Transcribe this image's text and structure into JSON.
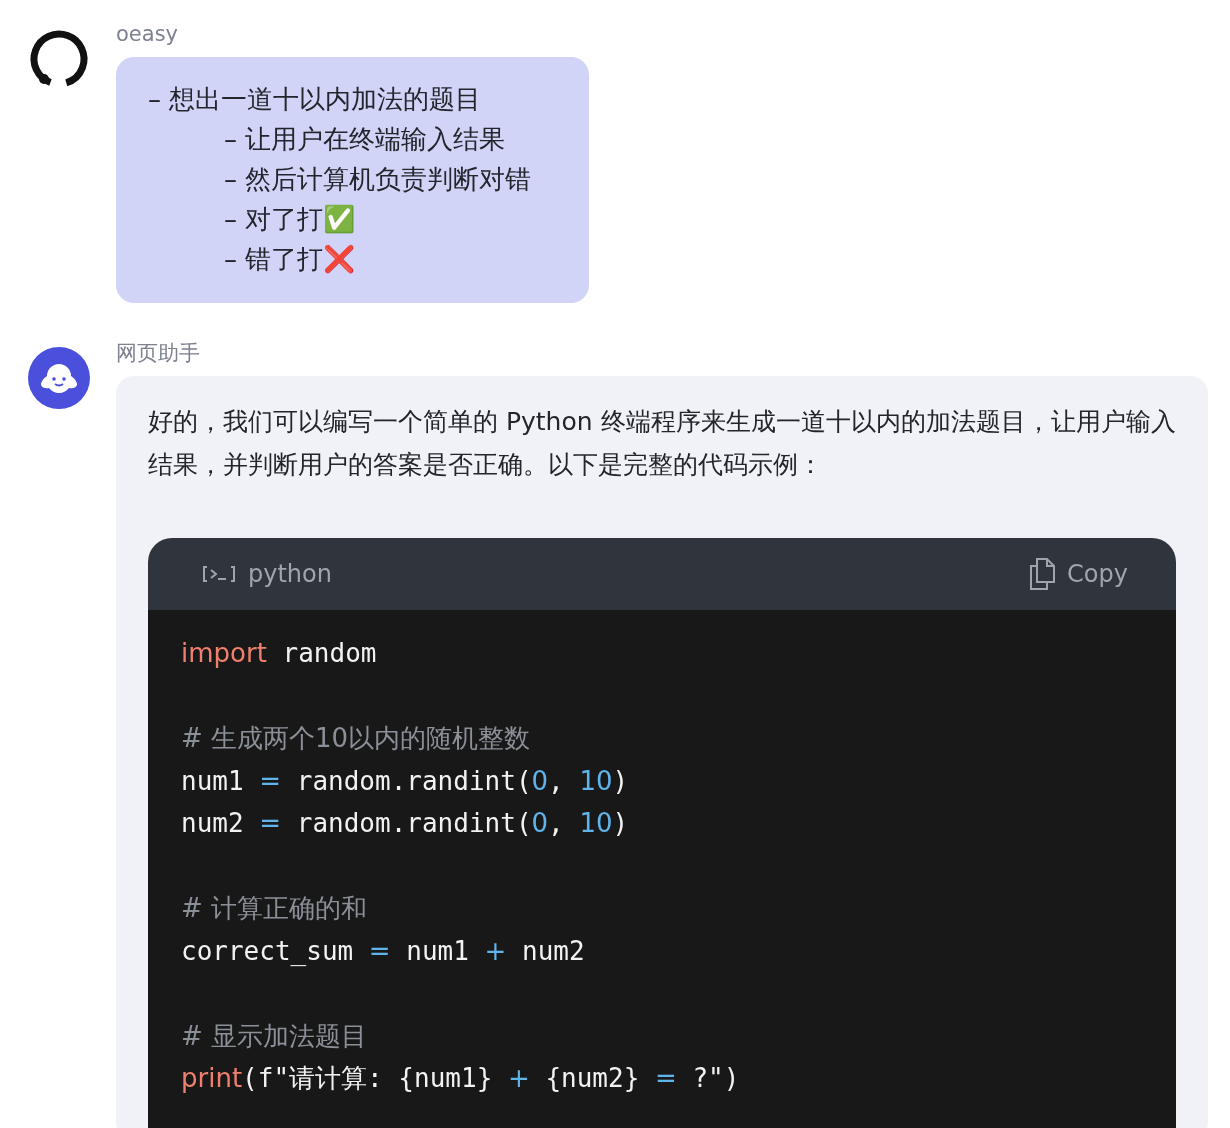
{
  "messages": [
    {
      "kind": "user",
      "sender": "oeasy",
      "items": [
        {
          "text": "– 想出一道十以内加法的题目",
          "children": [
            {
              "text": "– 让用户在终端输入结果"
            },
            {
              "text": "– 然后计算机负责判断对错"
            },
            {
              "text": "– 对了打✅"
            },
            {
              "text": "– 错了打❌"
            }
          ]
        }
      ]
    },
    {
      "kind": "assistant",
      "sender": "网页助手",
      "paragraph": "好的，我们可以编写一个简单的 Python 终端程序来生成一道十以内的加法题目，让用户输入结果，并判断用户的答案是否正确。以下是完整的代码示例：",
      "code": {
        "language": "python",
        "copy_label": "Copy",
        "lines": [
          {
            "kind": "code",
            "tokens": [
              {
                "kind": "keyword",
                "text": "import"
              },
              {
                "kind": "plain",
                "text": " random"
              }
            ]
          },
          {
            "kind": "blank"
          },
          {
            "kind": "code",
            "tokens": [
              {
                "kind": "comment",
                "text": "# 生成两个10以内的随机整数"
              }
            ]
          },
          {
            "kind": "code",
            "tokens": [
              {
                "kind": "plain",
                "text": "num1 "
              },
              {
                "kind": "op",
                "text": "="
              },
              {
                "kind": "plain",
                "text": " random.randint("
              },
              {
                "kind": "number",
                "text": "0"
              },
              {
                "kind": "plain",
                "text": ", "
              },
              {
                "kind": "number",
                "text": "10"
              },
              {
                "kind": "plain",
                "text": ")"
              }
            ]
          },
          {
            "kind": "code",
            "tokens": [
              {
                "kind": "plain",
                "text": "num2 "
              },
              {
                "kind": "op",
                "text": "="
              },
              {
                "kind": "plain",
                "text": " random.randint("
              },
              {
                "kind": "number",
                "text": "0"
              },
              {
                "kind": "plain",
                "text": ", "
              },
              {
                "kind": "number",
                "text": "10"
              },
              {
                "kind": "plain",
                "text": ")"
              }
            ]
          },
          {
            "kind": "blank"
          },
          {
            "kind": "code",
            "tokens": [
              {
                "kind": "comment",
                "text": "# 计算正确的和"
              }
            ]
          },
          {
            "kind": "code",
            "tokens": [
              {
                "kind": "plain",
                "text": "correct_sum "
              },
              {
                "kind": "op",
                "text": "="
              },
              {
                "kind": "plain",
                "text": " num1 "
              },
              {
                "kind": "op",
                "text": "+"
              },
              {
                "kind": "plain",
                "text": " num2"
              }
            ]
          },
          {
            "kind": "blank"
          },
          {
            "kind": "code",
            "tokens": [
              {
                "kind": "comment",
                "text": "# 显示加法题目"
              }
            ]
          },
          {
            "kind": "code",
            "tokens": [
              {
                "kind": "keyword",
                "text": "print"
              },
              {
                "kind": "plain",
                "text": "(f\"请计算: {num1} "
              },
              {
                "kind": "op",
                "text": "+"
              },
              {
                "kind": "plain",
                "text": " {num2} "
              },
              {
                "kind": "op",
                "text": "="
              },
              {
                "kind": "plain",
                "text": " ?\")"
              }
            ]
          }
        ]
      }
    }
  ]
}
